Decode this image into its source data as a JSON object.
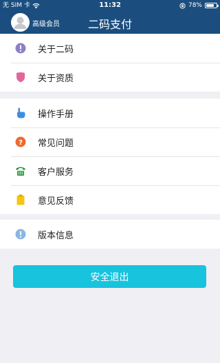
{
  "status_bar": {
    "carrier": "无 SIM 卡",
    "time": "11:32",
    "battery": "78%",
    "battery_level": 0.78
  },
  "header": {
    "member_label": "高级会员",
    "title": "二码支付"
  },
  "groups": [
    {
      "items": [
        {
          "label": "关于二码",
          "icon": "info-circle-icon",
          "color": "#8e7fc6"
        },
        {
          "label": "关于资质",
          "icon": "shield-badge-icon",
          "color": "#e2679a"
        }
      ]
    },
    {
      "items": [
        {
          "label": "操作手册",
          "icon": "hand-pointer-icon",
          "color": "#3e8de0"
        },
        {
          "label": "常见问题",
          "icon": "question-circle-icon",
          "color": "#ee6a30"
        },
        {
          "label": "客户服务",
          "icon": "phone-icon",
          "color": "#2b9a3f"
        },
        {
          "label": "意见反馈",
          "icon": "clipboard-icon",
          "color": "#f6c412"
        }
      ]
    },
    {
      "items": [
        {
          "label": "版本信息",
          "icon": "info-circle-icon",
          "color": "#8ab6e3"
        }
      ]
    }
  ],
  "logout_label": "安全退出"
}
